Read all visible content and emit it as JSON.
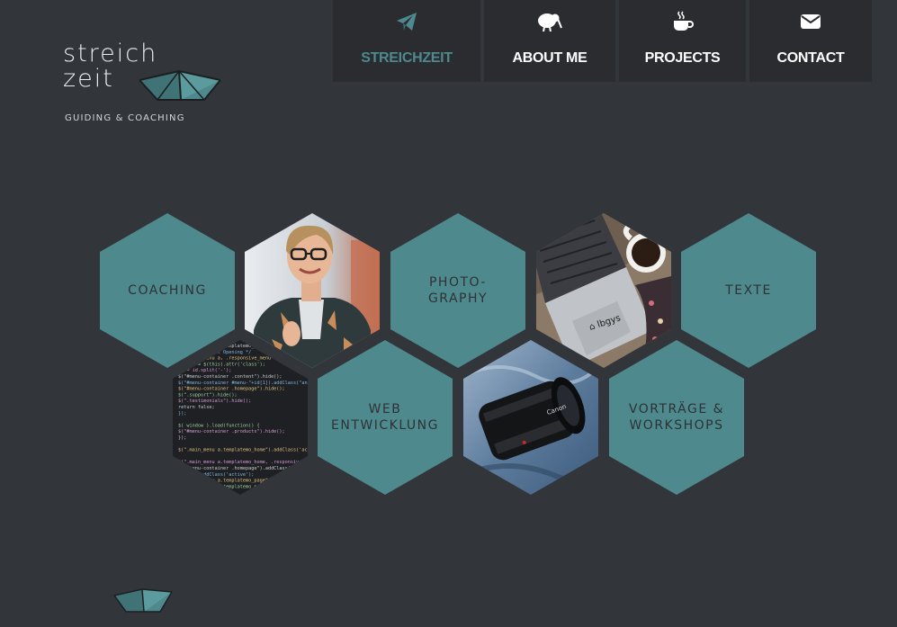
{
  "brand": {
    "line1": "streich",
    "line2": "zeit",
    "tagline": "Guiding & Coaching",
    "accent": "#4e8a8d",
    "background": "#32353a"
  },
  "nav": [
    {
      "label": "STREICHZEIT",
      "icon": "paper-plane-icon",
      "active": true
    },
    {
      "label": "ABOUT ME",
      "icon": "kiwi-bird-icon",
      "active": false
    },
    {
      "label": "PROJECTS",
      "icon": "coffee-cup-icon",
      "active": false
    },
    {
      "label": "CONTACT",
      "icon": "envelope-icon",
      "active": false
    }
  ],
  "tiles": {
    "coaching": "COACHING",
    "photography": "PHOTO-\nGRAPHY",
    "texte": "TEXTE",
    "web": "WEB\nENTWICKLUNG",
    "vortraege": "VORTRÄGE &\nWORKSHOPS"
  },
  "images": {
    "portrait": "portrait-photo",
    "laptop": "laptop-coffee-photo",
    "code": "code-editor-photo",
    "lens": "camera-lens-photo"
  },
  "code_lines": [
    "$(\".main_menu a.templatemo_home\")",
    "     /* Menu Content Opening */",
    "   $(\".main_menu a, .responsive_menu a\").click(",
    "   var id = $(this).attr('class');",
    "   id = id.split('-');",
    "   $(\"#menu-container .content\").hide();",
    "   $(\"#menu-container #menu-\"+id[1]).addClass(\"animat",
    "   $(\"#menu-container .homepage\").hide();",
    "   $(\".support\").hide();",
    "   $(\".testimonials\").hide();",
    "   return false;",
    "});",
    "",
    "$( window ).load(function() {",
    "  $(\"#menu-container .products\").hide();",
    "});",
    "",
    "$(\".main_menu a.templatemo_home\").addClass('active');",
    "",
    "$(\".main_menu a.templatemo_home, .responsive_menu",
    "   $(\"#menu-container .homepage\").addClass(\"",
    "   $(this).addClass('active');",
    "   $(\".main_menu a.templatemo_page\")",
    "   $(\".main_menu a.templatemo_page\")"
  ]
}
